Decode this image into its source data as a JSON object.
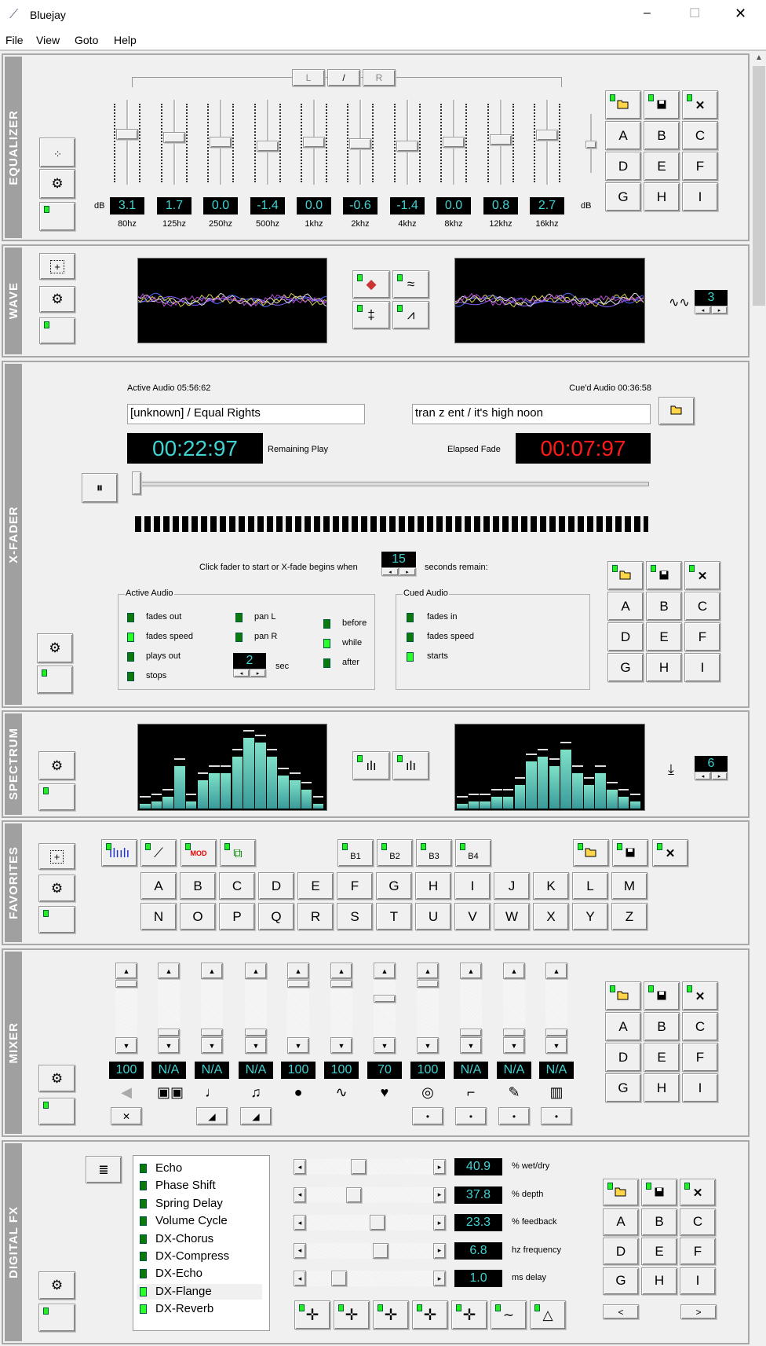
{
  "window": {
    "title": "Bluejay",
    "minimize": "–",
    "maximize": "☐",
    "close": "✕"
  },
  "menu": [
    "File",
    "View",
    "Goto",
    "Help"
  ],
  "colors": {
    "lcd_text": "#3fd3d3",
    "elapsed_text": "#ff1a1a",
    "led_on": "#2bff2b",
    "led_off": "#0b7a0b",
    "strip": "#a0a0a0"
  },
  "equalizer": {
    "label": "EQUALIZER",
    "channels": [
      "L",
      "/",
      "R"
    ],
    "db_label": "dB",
    "range_db": 15,
    "bands": [
      {
        "freq": "80hz",
        "value": "3.1"
      },
      {
        "freq": "125hz",
        "value": "1.7"
      },
      {
        "freq": "250hz",
        "value": "0.0"
      },
      {
        "freq": "500hz",
        "value": "-1.4"
      },
      {
        "freq": "1khz",
        "value": "0.0"
      },
      {
        "freq": "2khz",
        "value": "-0.6"
      },
      {
        "freq": "4khz",
        "value": "-1.4"
      },
      {
        "freq": "8khz",
        "value": "0.0"
      },
      {
        "freq": "12khz",
        "value": "0.8"
      },
      {
        "freq": "16khz",
        "value": "2.7"
      }
    ],
    "presets": [
      "A",
      "B",
      "C",
      "D",
      "E",
      "F",
      "G",
      "H",
      "I"
    ]
  },
  "wave": {
    "label": "WAVE",
    "count": "3",
    "presets": []
  },
  "xfader": {
    "label": "X-FADER",
    "active_caption": "Active Audio 05:56:62",
    "cued_caption": "Cue'd Audio 00:36:58",
    "active_track": "[unknown] / Equal Rights",
    "cued_track": "tran z ent / it's high noon",
    "remaining_time": "00:22:97",
    "remaining_label": "Remaining Play",
    "elapsed_label": "Elapsed Fade",
    "elapsed_time": "00:07:97",
    "fader_position": 0,
    "prompt": "Click fader to start or X-fade begins when",
    "seconds": "15",
    "seconds_label": "seconds remain:",
    "active_group": {
      "title": "Active Audio",
      "options": [
        {
          "label": "fades out",
          "on": false
        },
        {
          "label": "fades speed",
          "on": true
        },
        {
          "label": "plays out",
          "on": false
        },
        {
          "label": "stops",
          "on": false
        }
      ],
      "pan": [
        {
          "label": "pan L",
          "on": false
        },
        {
          "label": "pan R",
          "on": false
        }
      ],
      "sec_value": "2",
      "sec_label": "sec"
    },
    "timing": [
      {
        "label": "before",
        "on": false
      },
      {
        "label": "while",
        "on": true
      },
      {
        "label": "after",
        "on": false
      }
    ],
    "cued_group": {
      "title": "Cued Audio",
      "options": [
        {
          "label": "fades in",
          "on": false
        },
        {
          "label": "fades speed",
          "on": false
        },
        {
          "label": "starts",
          "on": true
        }
      ]
    },
    "presets": [
      "A",
      "B",
      "C",
      "D",
      "E",
      "F",
      "G",
      "H",
      "I"
    ]
  },
  "spectrum": {
    "label": "SPECTRUM",
    "count": "6",
    "left_levels": [
      0.02,
      0.03,
      0.05,
      0.18,
      0.03,
      0.12,
      0.15,
      0.15,
      0.22,
      0.3,
      0.28,
      0.22,
      0.14,
      0.12,
      0.08,
      0.02
    ],
    "right_levels": [
      0.02,
      0.03,
      0.03,
      0.05,
      0.05,
      0.1,
      0.2,
      0.22,
      0.18,
      0.25,
      0.15,
      0.1,
      0.15,
      0.08,
      0.05,
      0.03
    ]
  },
  "favorites": {
    "label": "FAVORITES",
    "mod_label": "MOD",
    "banks": [
      "B1",
      "B2",
      "B3",
      "B4"
    ],
    "letters": [
      "A",
      "B",
      "C",
      "D",
      "E",
      "F",
      "G",
      "H",
      "I",
      "J",
      "K",
      "L",
      "M",
      "N",
      "O",
      "P",
      "Q",
      "R",
      "S",
      "T",
      "U",
      "V",
      "W",
      "X",
      "Y",
      "Z"
    ]
  },
  "mixer": {
    "label": "MIXER",
    "channels": [
      {
        "value": "100",
        "icon": "speaker-icon",
        "glyph": "◀",
        "level": 1.0,
        "button": "✕"
      },
      {
        "value": "N/A",
        "icon": "speakers-icon",
        "glyph": "▣▣",
        "level": 0,
        "button": null
      },
      {
        "value": "N/A",
        "icon": "bass-clef-icon",
        "glyph": "♩",
        "level": 0,
        "button": "◢"
      },
      {
        "value": "N/A",
        "icon": "treble-clef-icon",
        "glyph": "♫",
        "level": 0,
        "button": "◢"
      },
      {
        "value": "100",
        "icon": "dot-icon",
        "glyph": "●",
        "level": 1.0,
        "button": null
      },
      {
        "value": "100",
        "icon": "waveform-icon",
        "glyph": "∿",
        "level": 1.0,
        "button": null
      },
      {
        "value": "70",
        "icon": "heart-icon",
        "glyph": "♥",
        "level": 0.7,
        "button": null
      },
      {
        "value": "100",
        "icon": "cd-icon",
        "glyph": "◎",
        "level": 1.0,
        "button": "•"
      },
      {
        "value": "N/A",
        "icon": "plug-icon",
        "glyph": "⌐",
        "level": 0,
        "button": "•"
      },
      {
        "value": "N/A",
        "icon": "microphone-icon",
        "glyph": "✎",
        "level": 0,
        "button": "•"
      },
      {
        "value": "N/A",
        "icon": "keyboard-icon",
        "glyph": "▥",
        "level": 0,
        "button": "•"
      }
    ],
    "presets": [
      "A",
      "B",
      "C",
      "D",
      "E",
      "F",
      "G",
      "H",
      "I"
    ]
  },
  "fx": {
    "label": "DIGITAL FX",
    "effects": [
      {
        "name": "Echo",
        "on": false
      },
      {
        "name": "Phase Shift",
        "on": false
      },
      {
        "name": "Spring Delay",
        "on": false
      },
      {
        "name": "Volume Cycle",
        "on": false
      },
      {
        "name": "DX-Chorus",
        "on": false
      },
      {
        "name": "DX-Compress",
        "on": false
      },
      {
        "name": "DX-Echo",
        "on": false
      },
      {
        "name": "DX-Flange",
        "on": true,
        "selected": true
      },
      {
        "name": "DX-Reverb",
        "on": true
      }
    ],
    "params": [
      {
        "value": "40.9",
        "label": "% wet/dry",
        "pos": 0.4
      },
      {
        "value": "37.8",
        "label": "% depth",
        "pos": 0.36
      },
      {
        "value": "23.3",
        "label": "% feedback",
        "pos": 0.57
      },
      {
        "value": "6.8",
        "label": "hz frequency",
        "pos": 0.6
      },
      {
        "value": "1.0",
        "label": "ms delay",
        "pos": 0.23
      }
    ],
    "presets": [
      "A",
      "B",
      "C",
      "D",
      "E",
      "F",
      "G",
      "H",
      "I"
    ],
    "prev": "<",
    "next": ">"
  }
}
